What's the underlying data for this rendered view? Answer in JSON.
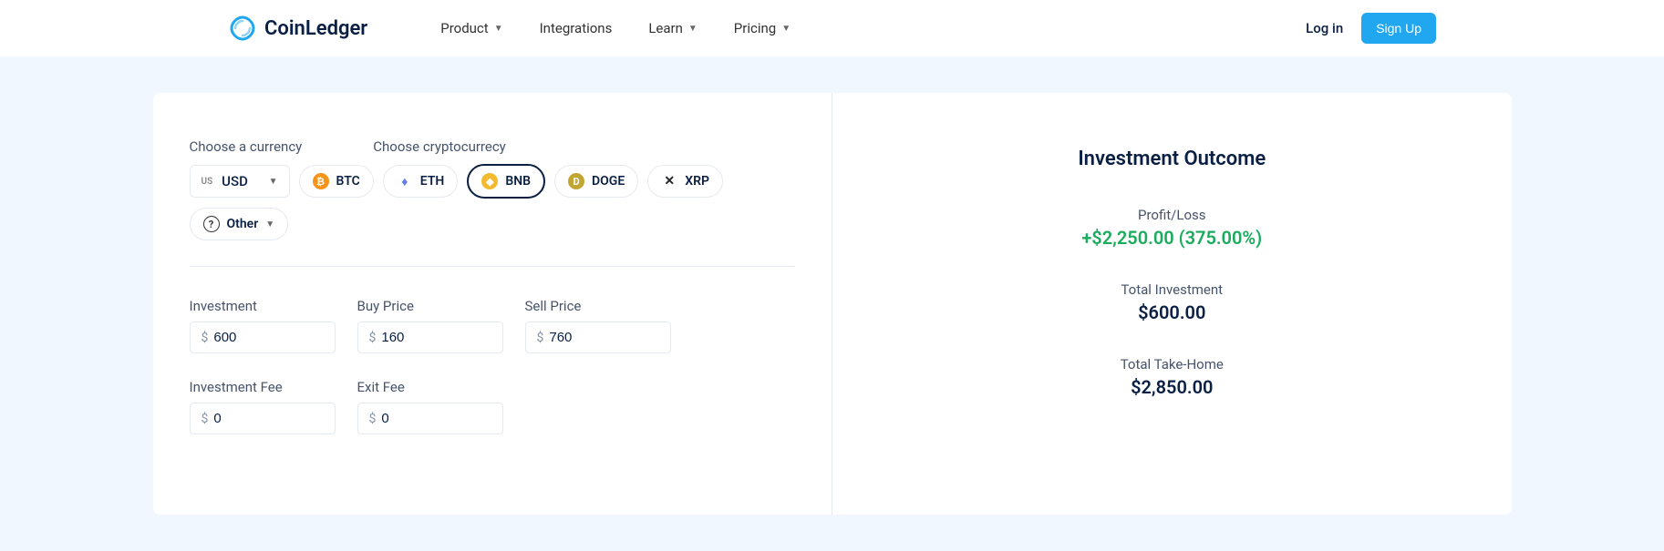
{
  "header": {
    "brand": "CoinLedger",
    "nav": {
      "product": "Product",
      "integrations": "Integrations",
      "learn": "Learn",
      "pricing": "Pricing"
    },
    "login": "Log in",
    "signup": "Sign Up"
  },
  "calculator": {
    "currency_label": "Choose a currency",
    "crypto_label": "Choose cryptocurrecy",
    "currency_flag": "US",
    "currency_code": "USD",
    "cryptos": {
      "btc": "BTC",
      "eth": "ETH",
      "bnb": "BNB",
      "doge": "DOGE",
      "xrp": "XRP",
      "other": "Other"
    },
    "fields": {
      "investment_label": "Investment",
      "investment_value": "600",
      "buy_label": "Buy Price",
      "buy_value": "160",
      "sell_label": "Sell Price",
      "sell_value": "760",
      "inv_fee_label": "Investment Fee",
      "inv_fee_value": "0",
      "exit_fee_label": "Exit Fee",
      "exit_fee_value": "0",
      "symbol": "$"
    }
  },
  "outcome": {
    "title": "Investment Outcome",
    "profit_label": "Profit/Loss",
    "profit_value": "+$2,250.00 (375.00%)",
    "total_inv_label": "Total Investment",
    "total_inv_value": "$600.00",
    "take_home_label": "Total Take-Home",
    "take_home_value": "$2,850.00"
  }
}
